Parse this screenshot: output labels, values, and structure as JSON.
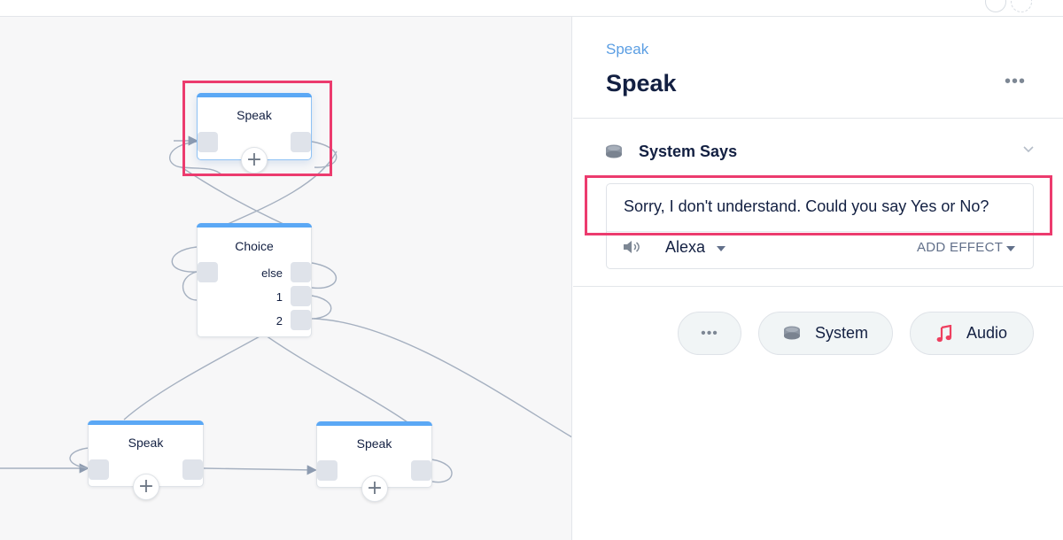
{
  "canvas": {
    "nodes": {
      "speak_top": {
        "title": "Speak"
      },
      "choice": {
        "title": "Choice",
        "ports": [
          "else",
          "1",
          "2"
        ]
      },
      "speak_left": {
        "title": "Speak"
      },
      "speak_right": {
        "title": "Speak"
      }
    },
    "add_symbol": "+"
  },
  "panel": {
    "breadcrumb": "Speak",
    "title": "Speak",
    "more_symbol": "•••",
    "section": {
      "label": "System Says",
      "icon": "system-voice-icon",
      "collapse_icon": "chevron-down-icon"
    },
    "speech": {
      "text": "Sorry, I don't understand. Could you say Yes or No?",
      "voice": "Alexa",
      "add_effect": "ADD EFFECT"
    },
    "buttons": {
      "more_symbol": "•••",
      "system": "System",
      "audio": "Audio"
    }
  },
  "colors": {
    "accent_blue": "#5ba8f5",
    "highlight": "#ec3b6e",
    "audio_icon": "#ee3f5f"
  }
}
